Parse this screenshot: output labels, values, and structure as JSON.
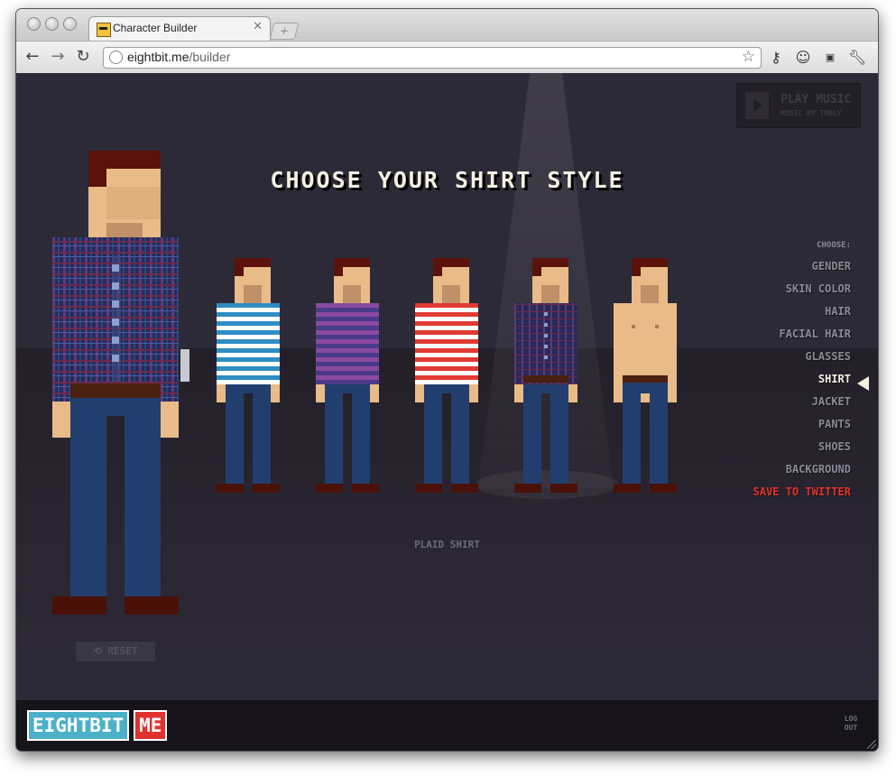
{
  "browser": {
    "tab_title": "Character Builder",
    "tab_close_icon": "close-icon",
    "new_tab_icon": "+",
    "url_domain": "eightbit.me",
    "url_path": "/builder"
  },
  "page": {
    "heading": "CHOOSE YOUR SHIRT STYLE",
    "music_title": "PLAY MUSIC",
    "music_subtitle": "MUSIC BY TOBLY",
    "selected_label": "PLAID SHIRT",
    "reset_label": "RESET",
    "menu_header": "CHOOSE:",
    "menu": [
      "GENDER",
      "SKIN COLOR",
      "HAIR",
      "FACIAL HAIR",
      "GLASSES",
      "SHIRT",
      "JACKET",
      "PANTS",
      "SHOES",
      "BACKGROUND",
      "SAVE TO TWITTER"
    ],
    "active_menu": "SHIRT",
    "logo_left": "EIGHTBIT",
    "logo_right": "ME",
    "logout": "LOG OUT"
  },
  "colors": {
    "skin": "#e8bb88",
    "hair": "#5a120a",
    "jeans": "#223e6e",
    "shoe": "#4a1108",
    "stripe_blue": "#2e8dc4",
    "stripe_purple": "#6e3e8e",
    "stripe_red": "#e03a34",
    "plaid": "#2c2c5a",
    "accent_red": "#e0322f",
    "logo_blue": "#4bb0c8"
  }
}
